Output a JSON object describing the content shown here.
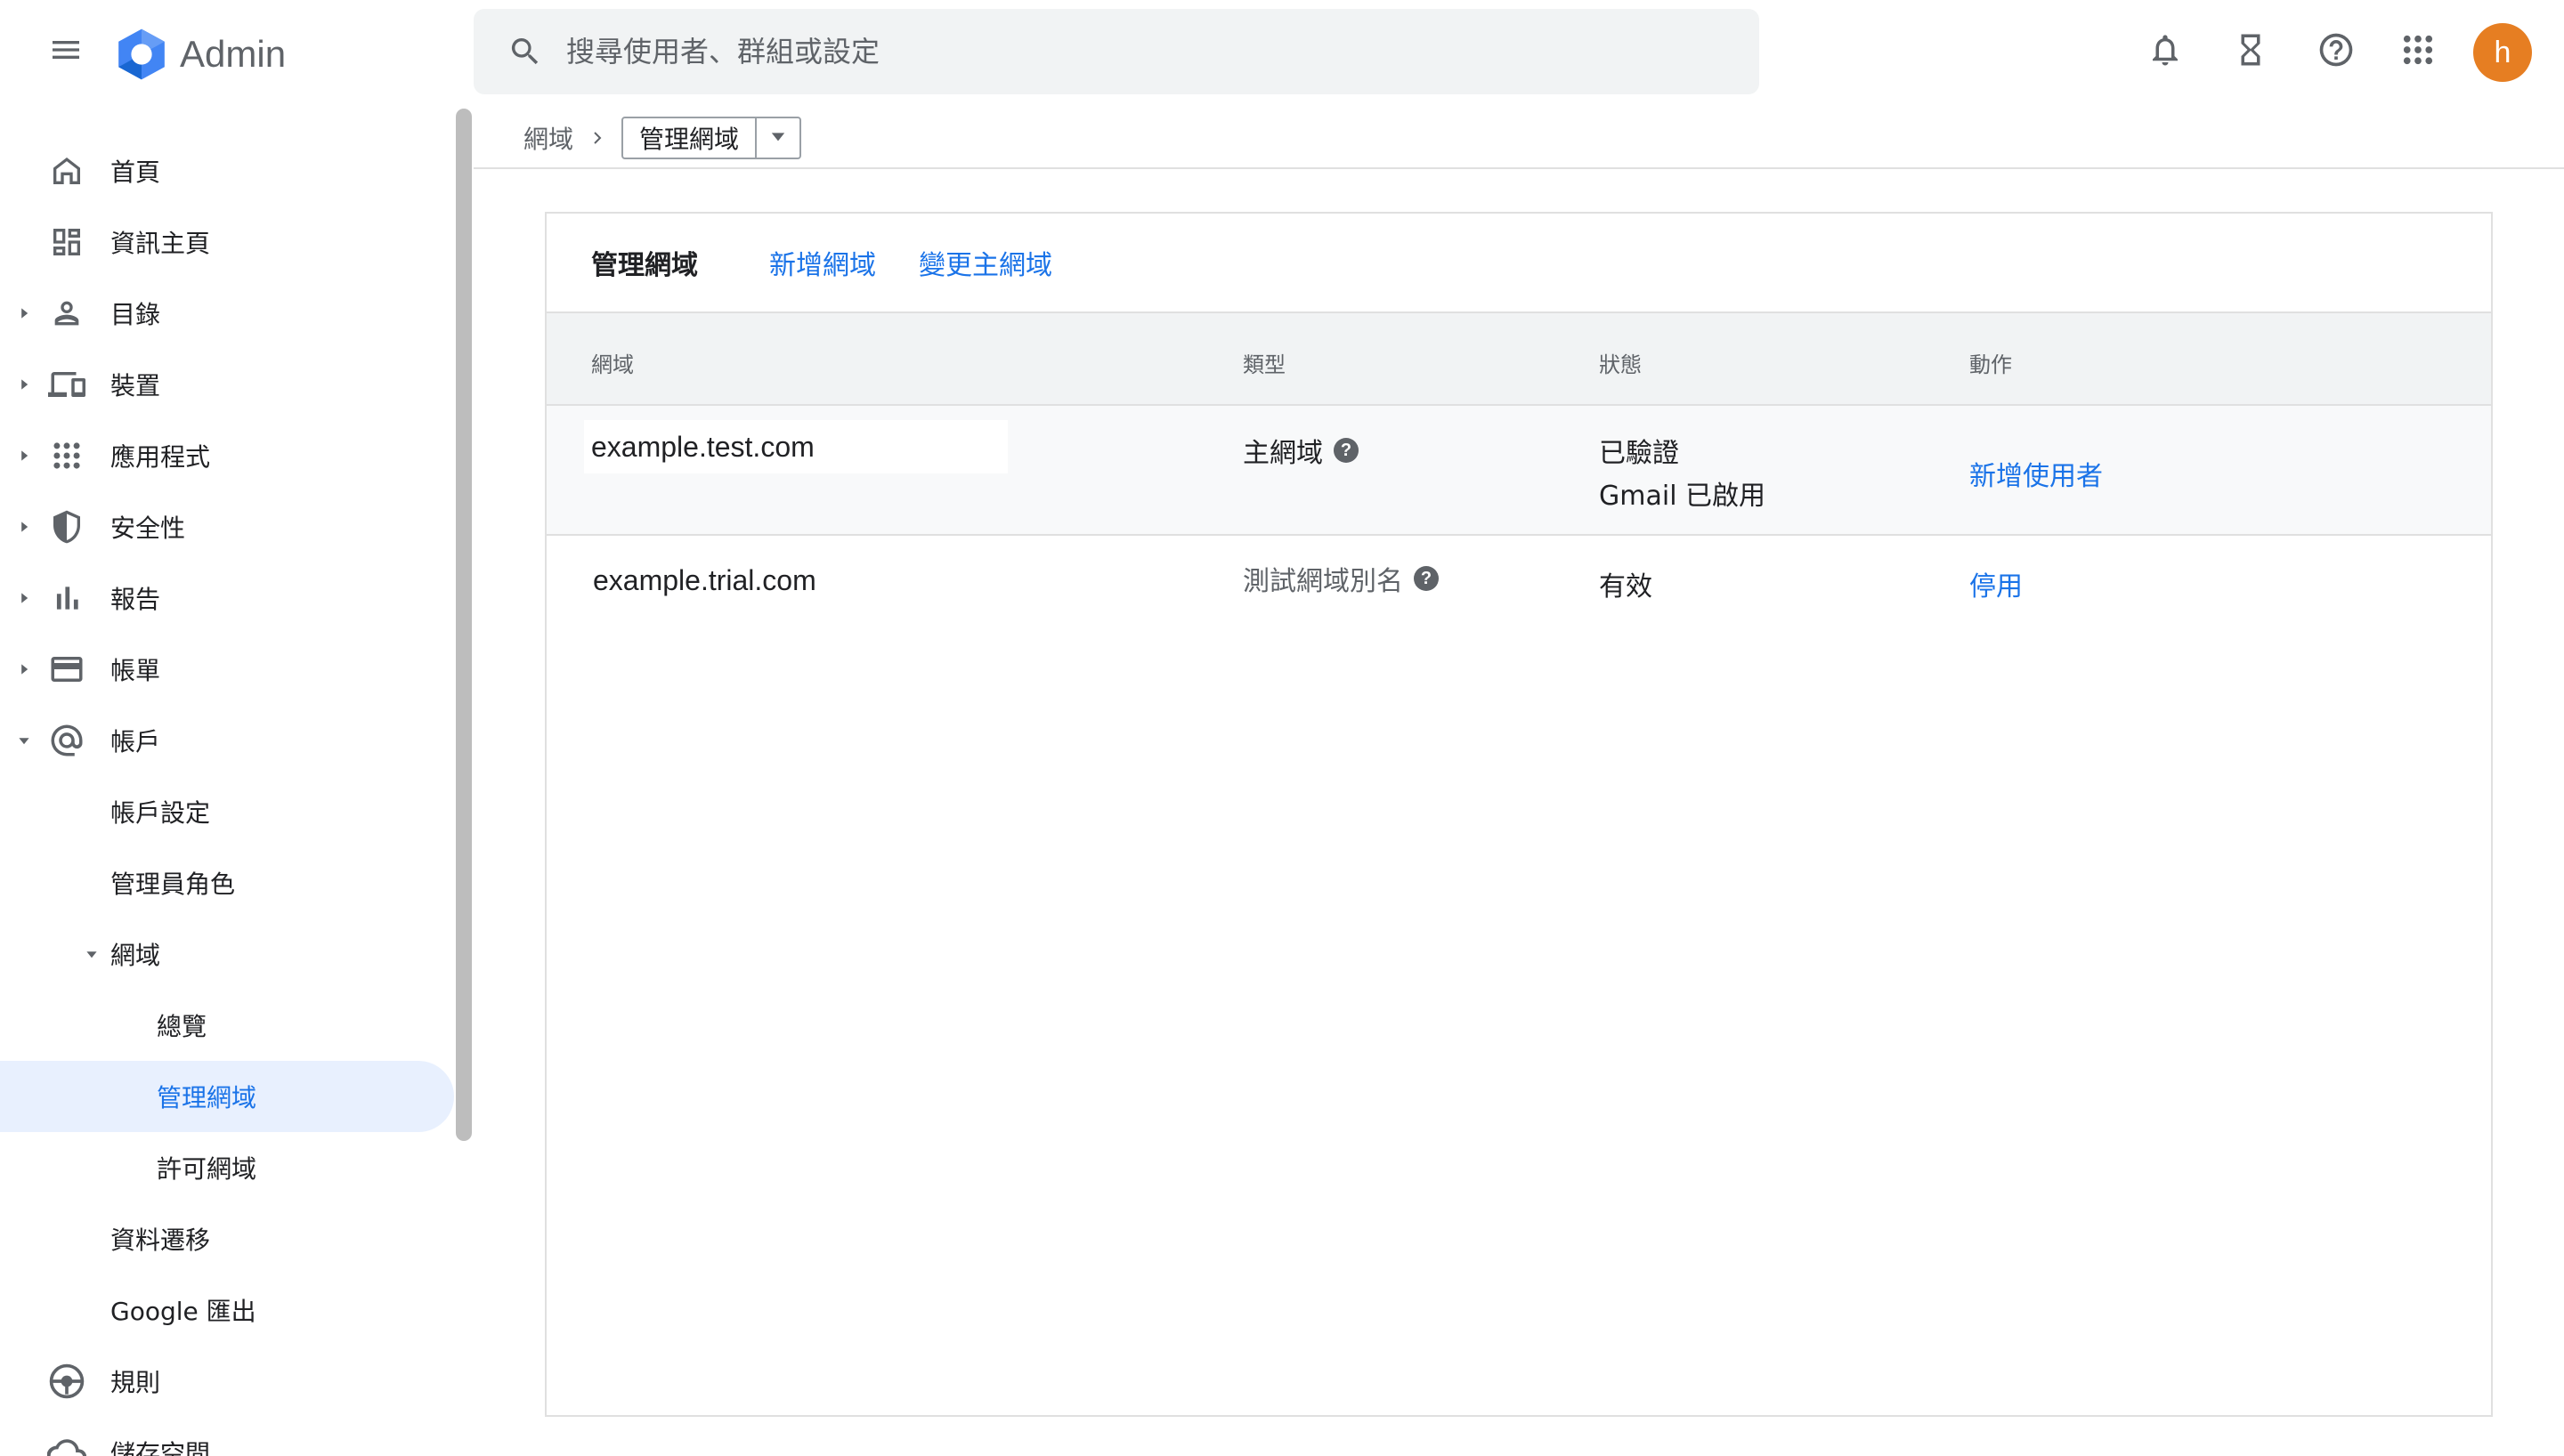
{
  "app": {
    "logo_text": "Admin"
  },
  "search": {
    "placeholder": "搜尋使用者、群組或設定"
  },
  "user": {
    "avatar_letter": "h"
  },
  "colors": {
    "accent": "#1a73e8",
    "active_bg": "#e8f0fe",
    "avatar": "#e67e22"
  },
  "sidebar": {
    "items": [
      {
        "label": "首頁",
        "icon": "home-icon"
      },
      {
        "label": "資訊主頁",
        "icon": "dashboard-icon"
      },
      {
        "label": "目錄",
        "icon": "person-icon"
      },
      {
        "label": "裝置",
        "icon": "devices-icon"
      },
      {
        "label": "應用程式",
        "icon": "apps-icon"
      },
      {
        "label": "安全性",
        "icon": "shield-icon"
      },
      {
        "label": "報告",
        "icon": "bar-chart-icon"
      },
      {
        "label": "帳單",
        "icon": "credit-card-icon"
      },
      {
        "label": "帳戶",
        "icon": "at-icon"
      },
      {
        "label": "帳戶設定"
      },
      {
        "label": "管理員角色"
      },
      {
        "label": "網域"
      },
      {
        "label": "總覽"
      },
      {
        "label": "管理網域"
      },
      {
        "label": "許可網域"
      },
      {
        "label": "資料遷移"
      },
      {
        "label": "Google 匯出"
      },
      {
        "label": "規則",
        "icon": "rules-icon"
      },
      {
        "label": "儲存空間",
        "icon": "cloud-icon"
      }
    ]
  },
  "breadcrumb": {
    "root": "網域",
    "current": "管理網域"
  },
  "card": {
    "title": "管理網域",
    "links": [
      "新增網域",
      "變更主網域"
    ]
  },
  "table": {
    "headers": [
      "網域",
      "類型",
      "狀態",
      "動作"
    ],
    "rows": [
      {
        "domain": "example.test.com",
        "type": "主網域",
        "status": [
          "已驗證",
          "Gmail 已啟用"
        ],
        "action": "新增使用者"
      },
      {
        "domain": "example.trial.com",
        "type": "測試網域別名",
        "status": [
          "有效"
        ],
        "action": "停用"
      }
    ]
  }
}
